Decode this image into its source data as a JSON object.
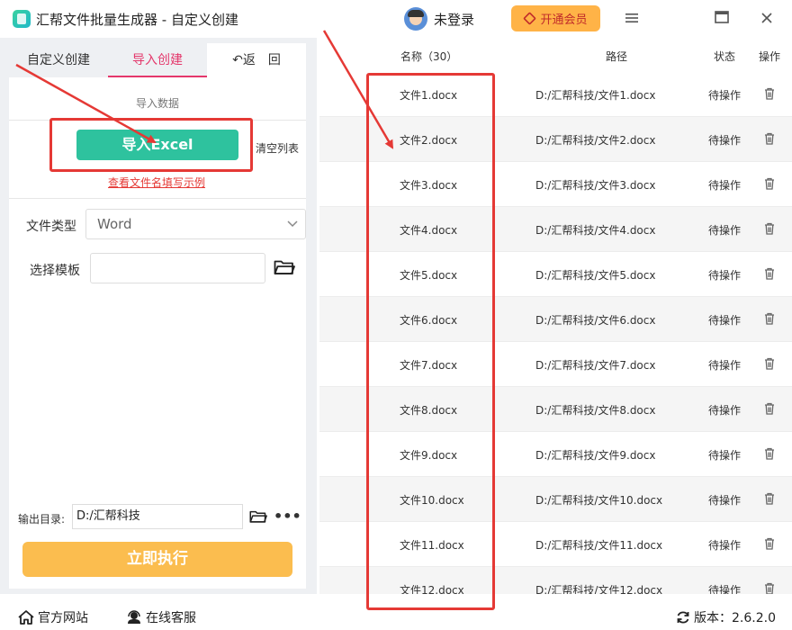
{
  "window": {
    "title": "汇帮文件批量生成器 - 自定义创建",
    "login_label": "未登录",
    "vip_label": "开通会员",
    "menu_icon": "menu-icon",
    "maximize_icon": "maximize-icon",
    "close_icon": "close-icon"
  },
  "tabs": [
    {
      "label": "自定义创建"
    },
    {
      "label": "导入创建"
    },
    {
      "label": "↶返　回"
    }
  ],
  "import": {
    "section_title": "导入数据",
    "import_button": "导入Excel",
    "clear_button": "清空列表",
    "example_link": "查看文件名填写示例"
  },
  "form": {
    "file_type_label": "文件类型",
    "file_type_value": "Word",
    "template_label": "选择模板",
    "template_value": "",
    "output_label": "输出目录:",
    "output_value": "D:/汇帮科技",
    "run_button": "立即执行"
  },
  "table": {
    "headers": {
      "name": "名称（30）",
      "path": "路径",
      "status": "状态",
      "action": "操作"
    },
    "rows": [
      {
        "name": "文件1.docx",
        "path": "D:/汇帮科技/文件1.docx",
        "status": "待操作"
      },
      {
        "name": "文件2.docx",
        "path": "D:/汇帮科技/文件2.docx",
        "status": "待操作"
      },
      {
        "name": "文件3.docx",
        "path": "D:/汇帮科技/文件3.docx",
        "status": "待操作"
      },
      {
        "name": "文件4.docx",
        "path": "D:/汇帮科技/文件4.docx",
        "status": "待操作"
      },
      {
        "name": "文件5.docx",
        "path": "D:/汇帮科技/文件5.docx",
        "status": "待操作"
      },
      {
        "name": "文件6.docx",
        "path": "D:/汇帮科技/文件6.docx",
        "status": "待操作"
      },
      {
        "name": "文件7.docx",
        "path": "D:/汇帮科技/文件7.docx",
        "status": "待操作"
      },
      {
        "name": "文件8.docx",
        "path": "D:/汇帮科技/文件8.docx",
        "status": "待操作"
      },
      {
        "name": "文件9.docx",
        "path": "D:/汇帮科技/文件9.docx",
        "status": "待操作"
      },
      {
        "name": "文件10.docx",
        "path": "D:/汇帮科技/文件10.docx",
        "status": "待操作"
      },
      {
        "name": "文件11.docx",
        "path": "D:/汇帮科技/文件11.docx",
        "status": "待操作"
      },
      {
        "name": "文件12.docx",
        "path": "D:/汇帮科技/文件12.docx",
        "status": "待操作"
      }
    ]
  },
  "footer": {
    "website": "官方网站",
    "support": "在线客服",
    "version": "版本：2.6.2.0"
  },
  "colors": {
    "accent_pink": "#e4376b",
    "import_green": "#2ec29e",
    "run_orange": "#fbbd4f",
    "vip_orange": "#ffb347",
    "annotation_red": "#e53935"
  }
}
